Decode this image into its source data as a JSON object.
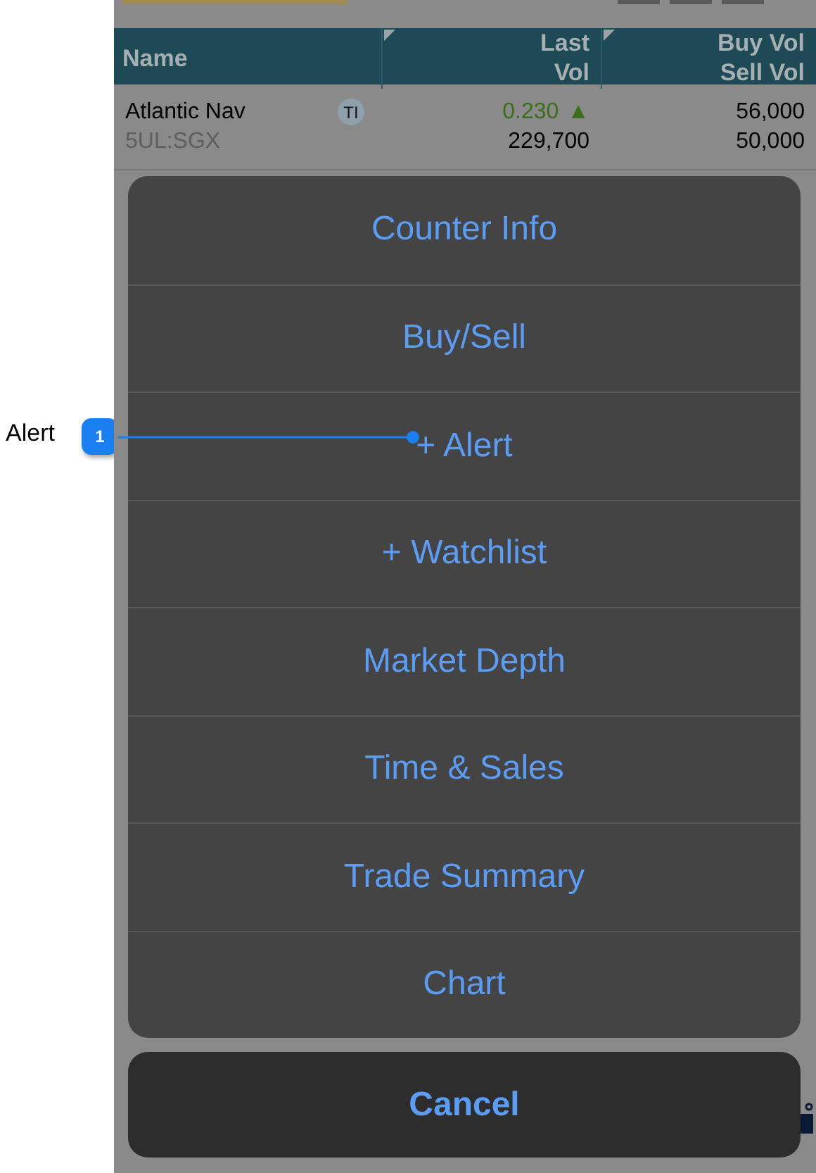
{
  "callout": {
    "label": "Alert",
    "badge": "1"
  },
  "table": {
    "columns": [
      {
        "lines": [
          "Name"
        ]
      },
      {
        "lines": [
          "Last",
          "Vol"
        ]
      },
      {
        "lines": [
          "Buy Vol",
          "Sell Vol"
        ]
      }
    ],
    "rows": [
      {
        "name": "Atlantic Nav",
        "tag": "TI",
        "code": "5UL:SGX",
        "last": "0.230",
        "trend": "▲",
        "vol": "229,700",
        "buy_vol": "56,000",
        "sell_vol": "50,000"
      }
    ]
  },
  "action_sheet": {
    "items": [
      "Counter Info",
      "Buy/Sell",
      "+ Alert",
      "+ Watchlist",
      "Market Depth",
      "Time & Sales",
      "Trade Summary",
      "Chart"
    ],
    "cancel": "Cancel"
  }
}
